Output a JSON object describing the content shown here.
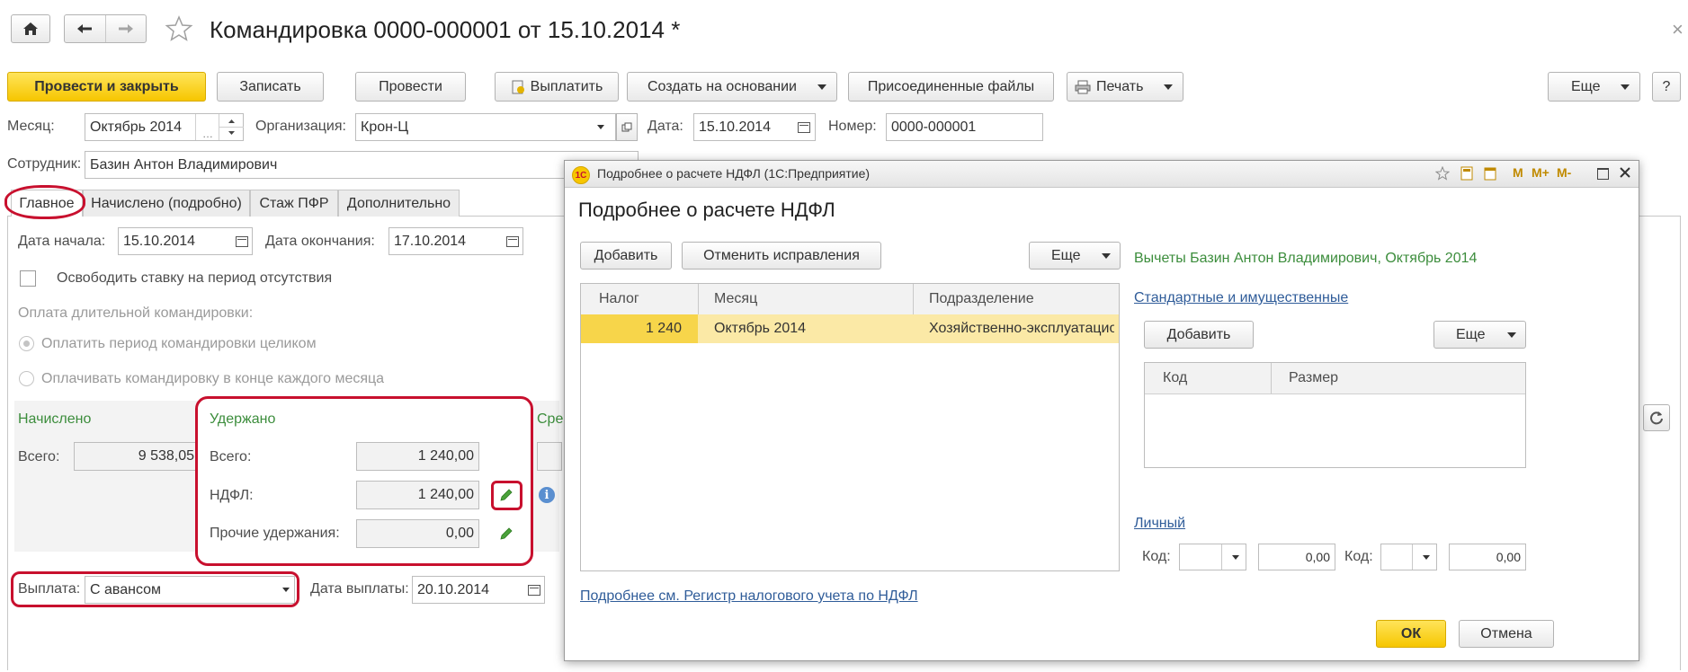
{
  "window": {
    "title": "Командировка 0000-000001 от 15.10.2014 *",
    "close_glyph": "×"
  },
  "toolbar": {
    "post_close": "Провести и закрыть",
    "save": "Записать",
    "post": "Провести",
    "pay": "Выплатить",
    "create_based": "Создать на основании",
    "attached_files": "Присоединенные файлы",
    "print": "Печать",
    "more": "Еще",
    "help": "?"
  },
  "header": {
    "month_label": "Месяц:",
    "month_value": "Октябрь 2014",
    "org_label": "Организация:",
    "org_value": "Крон-Ц",
    "date_label": "Дата:",
    "date_value": "15.10.2014",
    "number_label": "Номер:",
    "number_value": "0000-000001",
    "employee_label": "Сотрудник:",
    "employee_value": "Базин Антон Владимирович"
  },
  "tabs": [
    "Главное",
    "Начислено (подробно)",
    "Стаж ПФР",
    "Дополнительно"
  ],
  "main": {
    "start_label": "Дата начала:",
    "start_value": "15.10.2014",
    "end_label": "Дата окончания:",
    "end_value": "17.10.2014",
    "free_rate_label": "Освободить ставку на период отсутствия",
    "long_trip_label": "Оплата длительной командировки:",
    "radio1": "Оплатить период командировки целиком",
    "radio2": "Оплачивать командировку в конце каждого месяца",
    "accrued_title": "Начислено",
    "total_label": "Всего:",
    "accrued_total": "9 538,05",
    "withheld_title": "Удержано",
    "withheld_total_label": "Всего:",
    "withheld_total": "1 240,00",
    "ndfl_label": "НДФЛ:",
    "ndfl_value": "1 240,00",
    "other_label": "Прочие удержания:",
    "other_value": "0,00",
    "avg_title_fragment": "Сре",
    "payout_label": "Выплата:",
    "payout_value": "С авансом",
    "payout_date_label": "Дата выплаты:",
    "payout_date_value": "20.10.2014"
  },
  "dialog": {
    "window_title": "Подробнее о расчете НДФЛ (1С:Предприятие)",
    "logo": "1С",
    "title_icons": [
      "M",
      "M+",
      "M-"
    ],
    "heading": "Подробнее о расчете НДФЛ",
    "add": "Добавить",
    "cancel_corrections": "Отменить исправления",
    "more": "Еще",
    "table_headers": [
      "Налог",
      "Месяц",
      "Подразделение"
    ],
    "table_rows": [
      {
        "tax": "1 240",
        "month": "Октябрь 2014",
        "dept": "Хозяйственно-эксплуатационное упра..."
      }
    ],
    "register_link": "Подробнее см. Регистр налогового учета по НДФЛ",
    "deductions_title": "Вычеты Базин Антон Владимирович, Октябрь 2014",
    "standard_link": "Стандартные и имущественные",
    "add2": "Добавить",
    "more2": "Еще",
    "deduction_headers": [
      "Код",
      "Размер"
    ],
    "personal_link": "Личный",
    "code_label": "Код:",
    "code1_amount": "0,00",
    "code2_label": "Код:",
    "code2_amount": "0,00",
    "ok": "ОК",
    "cancel": "Отмена"
  },
  "colors": {
    "accent_yellow": "#f6c600",
    "selected_row": "#fbe9a6",
    "selected_cell": "#f7d54a",
    "highlight_red": "#c8102e",
    "green_title": "#3c8d3c",
    "link_blue": "#2f5c99"
  }
}
